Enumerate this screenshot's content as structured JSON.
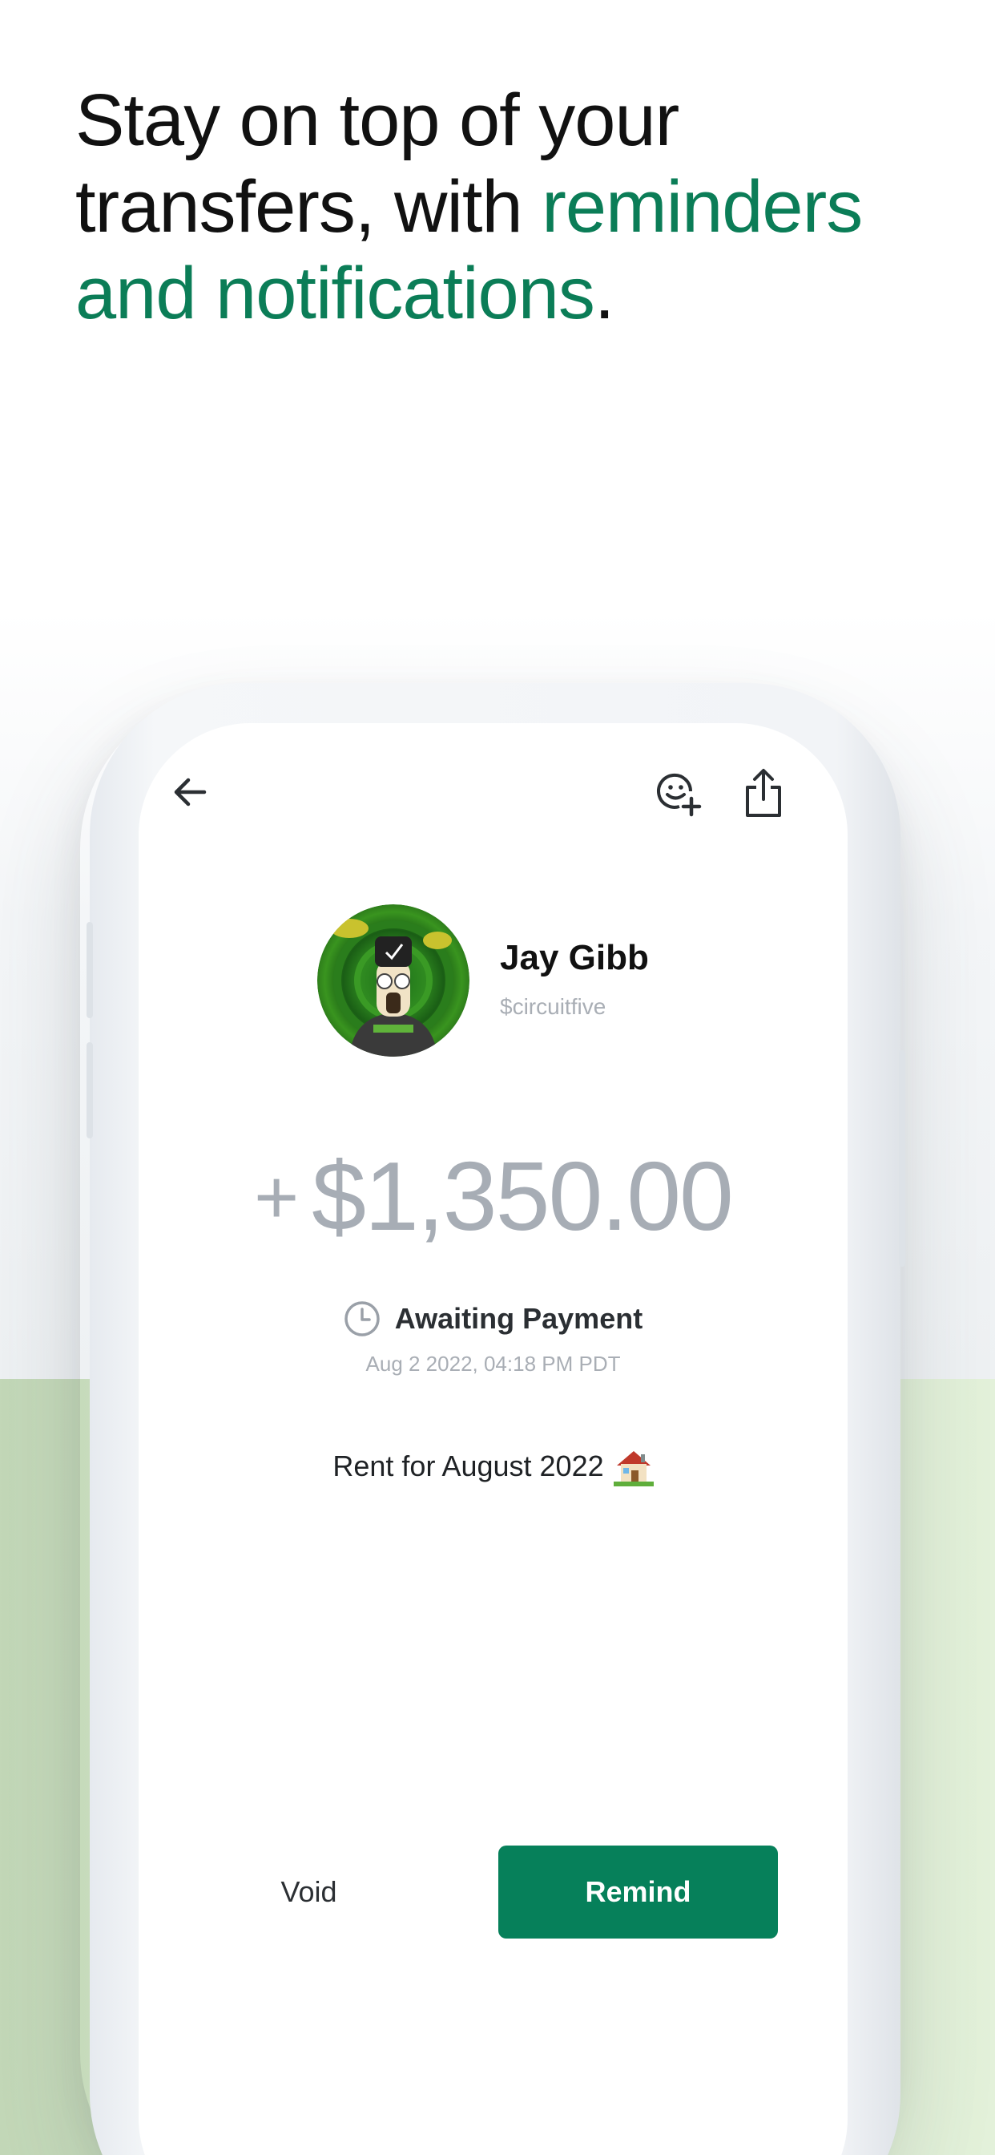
{
  "headline": {
    "line1": "Stay on top of your",
    "line2_plain": "transfers, with ",
    "line2_accent": "reminders",
    "line3_accent": "and notifications",
    "line3_end": "."
  },
  "colors": {
    "accent": "#0b7d57",
    "remind_button": "#06805a",
    "amount_text": "#a7adb5",
    "background_band": "#d4e7c8"
  },
  "toolbar": {
    "back_icon": "arrow-left-icon",
    "reaction_icon": "emoji-add-icon",
    "share_icon": "share-icon"
  },
  "contact": {
    "name": "Jay Gibb",
    "handle": "$circuitfive"
  },
  "payment": {
    "sign": "+",
    "amount": "$1,350.00",
    "status_icon": "clock-icon",
    "status": "Awaiting Payment",
    "timestamp": "Aug 2 2022, 04:18 PM PDT",
    "memo": "Rent for August 2022",
    "memo_icon": "house-emoji-icon"
  },
  "actions": {
    "void_label": "Void",
    "remind_label": "Remind"
  }
}
